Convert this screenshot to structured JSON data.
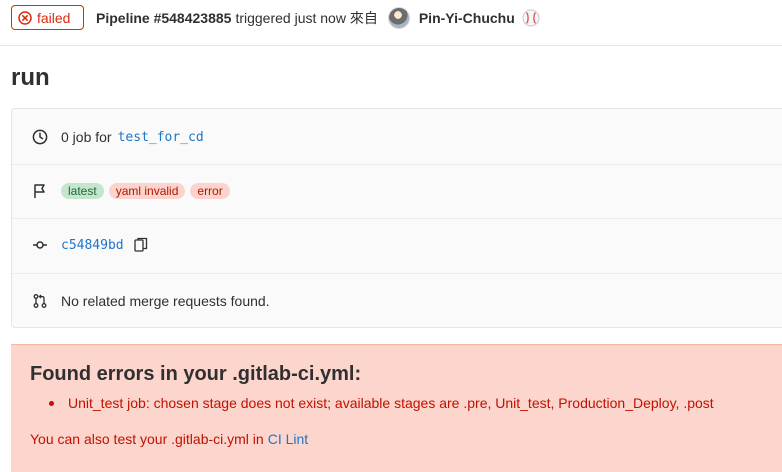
{
  "header": {
    "status_label": "failed",
    "pipeline_id": "Pipeline #548423885",
    "triggered_text": "triggered just now 來自",
    "user_name": "Pin-Yi-Chuchu"
  },
  "page_title": "run",
  "info": {
    "jobs_count_text": "0 job for",
    "branch": "test_for_cd",
    "badges": [
      "latest",
      "yaml invalid",
      "error"
    ],
    "commit_sha": "c54849bd",
    "merge_requests_text": "No related merge requests found."
  },
  "error": {
    "title": "Found errors in your .gitlab-ci.yml:",
    "items": [
      "Unit_test job: chosen stage does not exist; available stages are .pre, Unit_test, Production_Deploy, .post"
    ],
    "footer_text": "You can also test your .gitlab-ci.yml in",
    "footer_link": "CI Lint"
  },
  "icons": {
    "status": "error-circle-icon",
    "clock": "clock-icon",
    "flag": "flag-icon",
    "commit": "commit-icon",
    "copy": "copy-icon",
    "merge_request": "merge-request-icon",
    "user_status_emoji": "baseball-icon"
  },
  "colors": {
    "danger": "#dd2b0e",
    "link": "#1f75cb",
    "error_bg": "#fcd5cd",
    "badge_green_bg": "#c3e6cd",
    "badge_red_bg": "#fdd4cd"
  }
}
